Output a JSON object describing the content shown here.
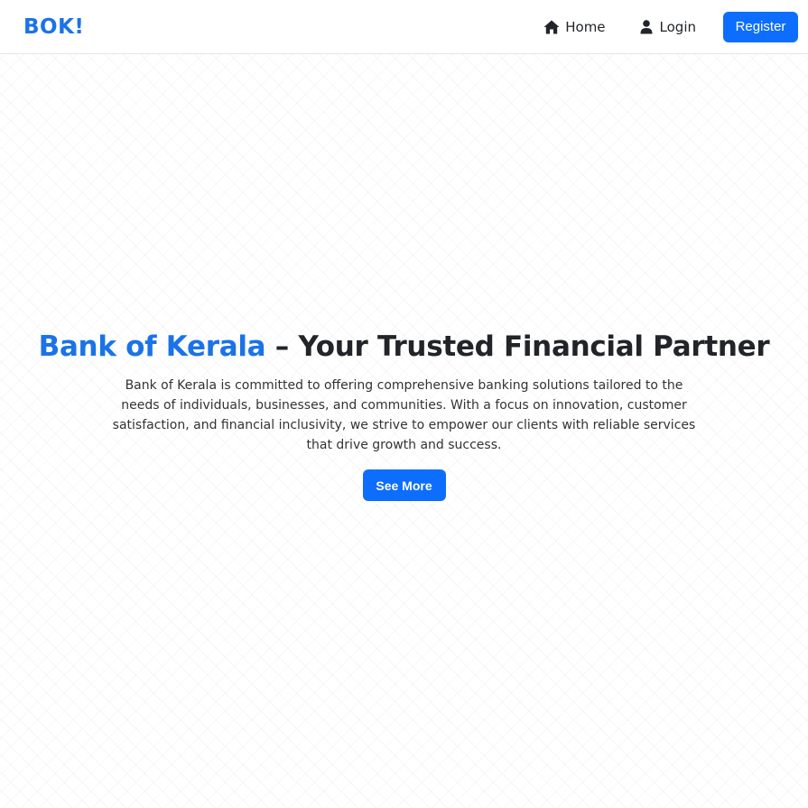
{
  "navbar": {
    "brand": "BOK!",
    "links": {
      "home": {
        "label": "Home",
        "icon": "home-icon"
      },
      "login": {
        "label": "Login",
        "icon": "user-icon"
      }
    },
    "register_label": "Register"
  },
  "hero": {
    "title_accent": "Bank of Kerala",
    "title_rest": " – Your Trusted Financial Partner",
    "description": "Bank of Kerala is committed to offering comprehensive banking solutions tailored to the needs of individuals, businesses, and communities. With a focus on innovation, customer satisfaction, and financial inclusivity, we strive to empower our clients with reliable services that drive growth and success.",
    "cta_label": "See More"
  },
  "colors": {
    "brand": "#1a73e8",
    "primary_button": "#0d6efd",
    "text": "#212529"
  }
}
